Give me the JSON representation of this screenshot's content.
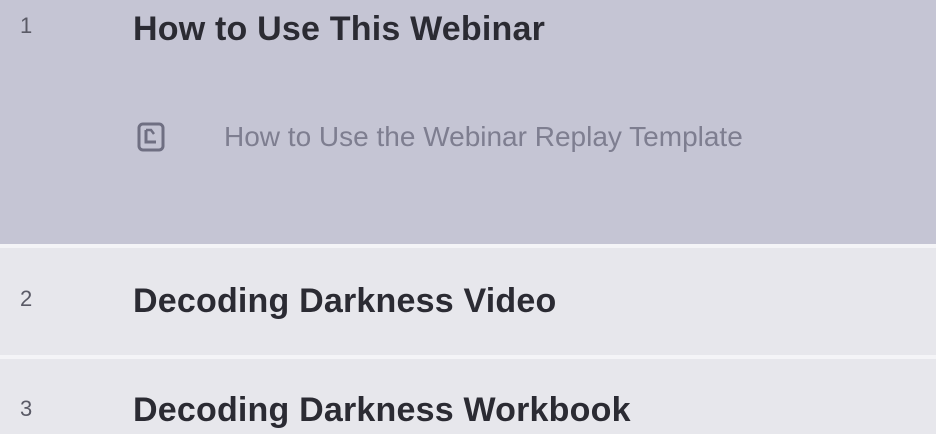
{
  "modules": [
    {
      "number": "1",
      "title": "How to Use This Webinar",
      "lessons": [
        {
          "label": "How to Use the Webinar Replay Template",
          "icon": "document-icon"
        }
      ]
    },
    {
      "number": "2",
      "title": "Decoding Darkness Video"
    },
    {
      "number": "3",
      "title": "Decoding Darkness Workbook"
    }
  ],
  "colors": {
    "active_module_bg": "#c5c5d4",
    "module_bg": "#e7e7ec",
    "divider": "#f4f4f7",
    "title_text": "#2b2b33",
    "lesson_text": "#7e7e90"
  }
}
